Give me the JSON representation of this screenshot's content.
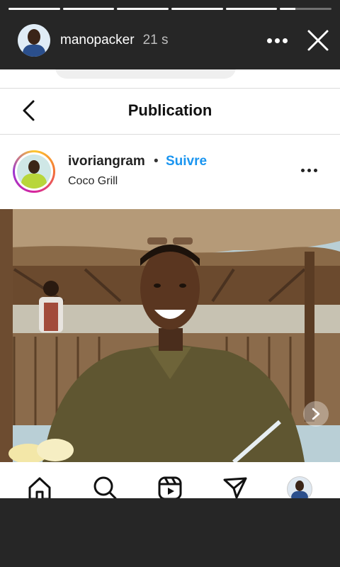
{
  "story": {
    "username": "manopacker",
    "elapsed": "21 s",
    "progress": [
      1,
      1,
      1,
      1,
      1,
      0.3
    ]
  },
  "post_screen": {
    "title": "Publication",
    "author": {
      "username": "ivoriangram",
      "separator": "•",
      "follow_label": "Suivre",
      "location": "Coco Grill"
    }
  },
  "tabbar": {
    "items": [
      "home-icon",
      "search-icon",
      "reels-icon",
      "direct-icon",
      "profile-avatar"
    ]
  },
  "colors": {
    "story_background": "#262626",
    "follow_blue": "#1a95f0"
  }
}
